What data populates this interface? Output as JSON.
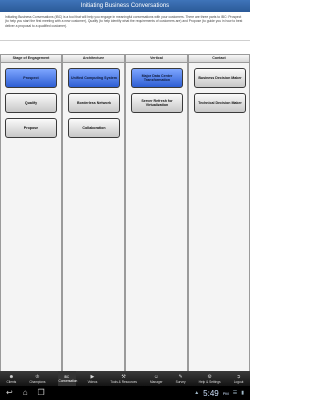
{
  "app": {
    "title": "Initiating Business Conversations"
  },
  "intro_text": "Initiating Business Conversations (IBC) is a tool that will help you engage in meaningful conversations with your customers. There are three parts to IBC: Prospect (to help you start the first meeting with a new customer), Qualify (to help identify what the requirements of customers are) and Propose (to guide you in how to best deliver a proposal to a qualified customer).",
  "columns": [
    {
      "header": "Stage of Engagement",
      "items": [
        {
          "label": "Prospect",
          "state": "selected"
        },
        {
          "label": "Qualify",
          "state": "normal"
        },
        {
          "label": "Propose",
          "state": "normal"
        }
      ]
    },
    {
      "header": "Architecture",
      "items": [
        {
          "label": "Unified Computing System",
          "state": "selected"
        },
        {
          "label": "Borderless Network",
          "state": "normal"
        },
        {
          "label": "Collaboration",
          "state": "normal"
        }
      ]
    },
    {
      "header": "Vertical",
      "items": [
        {
          "label": "Major Data Center Transformation",
          "state": "selected"
        },
        {
          "label": "Server Refresh for Virtualization",
          "state": "normal"
        }
      ]
    },
    {
      "header": "Contact",
      "items": [
        {
          "label": "Business Decision Maker",
          "state": "normal"
        },
        {
          "label": "Technical Decision Maker",
          "state": "normal"
        }
      ]
    }
  ],
  "nav": [
    {
      "label": "Clients",
      "icon": "clients-icon"
    },
    {
      "label": "Champions",
      "icon": "champions-icon"
    },
    {
      "label": "IBC Conversation",
      "icon": "ibc-icon",
      "active": true
    },
    {
      "label": "Videos",
      "icon": "videos-icon"
    },
    {
      "label": "Tools & Resources",
      "icon": "tools-icon"
    },
    {
      "label": "Manager",
      "icon": "manager-icon"
    },
    {
      "label": "Survey",
      "icon": "survey-icon"
    },
    {
      "label": "Help & Settings",
      "icon": "settings-icon"
    },
    {
      "label": "Logout",
      "icon": "logout-icon"
    }
  ],
  "system_bar": {
    "time": "5:49",
    "ampm": "PM",
    "icons": [
      "back-icon",
      "home-icon",
      "recent-apps-icon",
      "wifi-icon",
      "battery-icon"
    ]
  },
  "colors": {
    "title_bar": "#2f64a8",
    "selected_button": "#3b6fe0",
    "nav_bar": "#1a1a1a"
  }
}
